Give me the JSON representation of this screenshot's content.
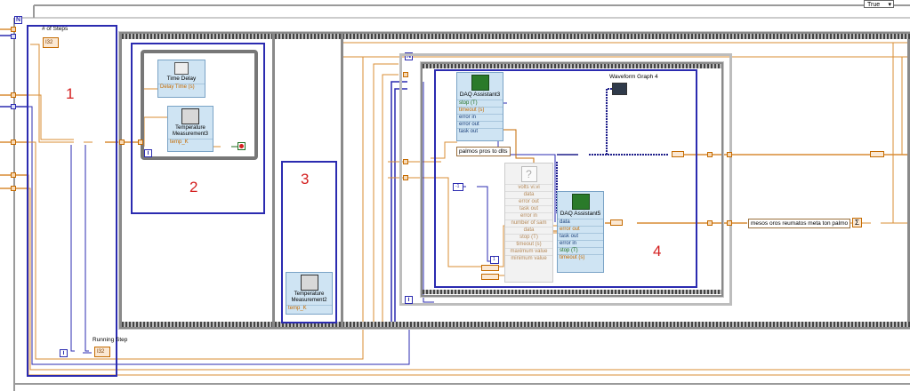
{
  "frame": {
    "selector_value": "True"
  },
  "labels": {
    "steps_label": "# of Steps",
    "steps_const": "I32",
    "running_step_label": "Running Step",
    "running_step_const": "I32",
    "waveform_graph": "Waveform Graph 4"
  },
  "sections": {
    "one": "1",
    "two": "2",
    "three": "3",
    "four": "4"
  },
  "loop_terminals": {
    "n": "N",
    "i": "i",
    "n2": "N",
    "i2": "i",
    "i3": "i"
  },
  "time_delay": {
    "title": "Time Delay",
    "input": "Delay Time (s)"
  },
  "temp3": {
    "title": "Temperature Measurement3",
    "output": "temp_K"
  },
  "temp2": {
    "title": "Temperature Measurement2",
    "output": "temp_K"
  },
  "daq3": {
    "title": "DAQ Assistant3",
    "rows": [
      "stop (T)",
      "timeout (s)",
      "error in",
      "error out",
      "task out"
    ]
  },
  "daq5": {
    "title": "DAQ Assistant5",
    "rows": [
      "data",
      "error out",
      "task out",
      "error in",
      "stop (T)",
      "timeout (s)"
    ]
  },
  "volts_vi": {
    "title": "volts vi.vi",
    "rows": [
      "data",
      "error out",
      "task out",
      "error in",
      "number of sam",
      "data",
      "stop (T)",
      "timeout (s)",
      "maximum value",
      "minimum value"
    ]
  },
  "strings": {
    "palmos": "palmos pros to dlts",
    "mesos": "mesos oros reumatos meta ton palmo"
  },
  "constants": {
    "minus_one": "-1",
    "one": "1"
  }
}
